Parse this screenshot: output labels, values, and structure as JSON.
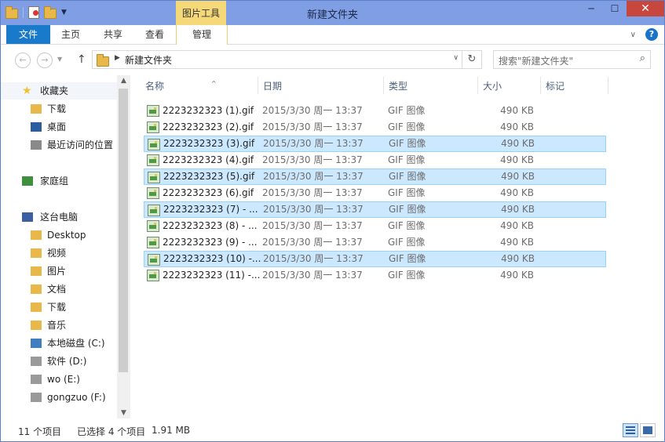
{
  "window": {
    "title": "新建文件夹",
    "context_tab": "图片工具"
  },
  "ribbon": {
    "tabs": [
      "文件",
      "主页",
      "共享",
      "查看",
      "管理"
    ]
  },
  "address": {
    "path": "新建文件夹",
    "search_placeholder": "搜索\"新建文件夹\""
  },
  "sidebar": {
    "items": [
      {
        "label": "收藏夹",
        "icon": "star-icon"
      },
      {
        "label": "下载",
        "icon": "downloads-folder-icon"
      },
      {
        "label": "桌面",
        "icon": "desktop-icon"
      },
      {
        "label": "最近访问的位置",
        "icon": "recent-places-icon"
      },
      {
        "label": "家庭组",
        "icon": "homegroup-icon"
      },
      {
        "label": "这台电脑",
        "icon": "computer-icon"
      },
      {
        "label": "Desktop",
        "icon": "folder-icon"
      },
      {
        "label": "视频",
        "icon": "videos-folder-icon"
      },
      {
        "label": "图片",
        "icon": "pictures-folder-icon"
      },
      {
        "label": "文档",
        "icon": "documents-folder-icon"
      },
      {
        "label": "下载",
        "icon": "downloads-folder-icon"
      },
      {
        "label": "音乐",
        "icon": "music-folder-icon"
      },
      {
        "label": "本地磁盘 (C:)",
        "icon": "system-drive-icon"
      },
      {
        "label": "软件 (D:)",
        "icon": "drive-icon"
      },
      {
        "label": "wo (E:)",
        "icon": "drive-icon"
      },
      {
        "label": "gongzuo (F:)",
        "icon": "drive-icon"
      }
    ]
  },
  "columns": [
    "名称",
    "日期",
    "类型",
    "大小",
    "标记"
  ],
  "files": [
    {
      "name": "2223232323 (1).gif",
      "date": "2015/3/30 周一 13:37",
      "type": "GIF 图像",
      "size": "490 KB",
      "selected": false
    },
    {
      "name": "2223232323 (2).gif",
      "date": "2015/3/30 周一 13:37",
      "type": "GIF 图像",
      "size": "490 KB",
      "selected": false
    },
    {
      "name": "2223232323 (3).gif",
      "date": "2015/3/30 周一 13:37",
      "type": "GIF 图像",
      "size": "490 KB",
      "selected": true
    },
    {
      "name": "2223232323 (4).gif",
      "date": "2015/3/30 周一 13:37",
      "type": "GIF 图像",
      "size": "490 KB",
      "selected": false
    },
    {
      "name": "2223232323 (5).gif",
      "date": "2015/3/30 周一 13:37",
      "type": "GIF 图像",
      "size": "490 KB",
      "selected": true
    },
    {
      "name": "2223232323 (6).gif",
      "date": "2015/3/30 周一 13:37",
      "type": "GIF 图像",
      "size": "490 KB",
      "selected": false
    },
    {
      "name": "2223232323 (7) - ...",
      "date": "2015/3/30 周一 13:37",
      "type": "GIF 图像",
      "size": "490 KB",
      "selected": true
    },
    {
      "name": "2223232323 (8) - ...",
      "date": "2015/3/30 周一 13:37",
      "type": "GIF 图像",
      "size": "490 KB",
      "selected": false
    },
    {
      "name": "2223232323 (9) - ...",
      "date": "2015/3/30 周一 13:37",
      "type": "GIF 图像",
      "size": "490 KB",
      "selected": false
    },
    {
      "name": "2223232323 (10) -...",
      "date": "2015/3/30 周一 13:37",
      "type": "GIF 图像",
      "size": "490 KB",
      "selected": true
    },
    {
      "name": "2223232323 (11) -...",
      "date": "2015/3/30 周一 13:37",
      "type": "GIF 图像",
      "size": "490 KB",
      "selected": false
    }
  ],
  "status": {
    "count": "11 个项目",
    "selection": "已选择 4 个项目",
    "size": "1.91 MB"
  }
}
